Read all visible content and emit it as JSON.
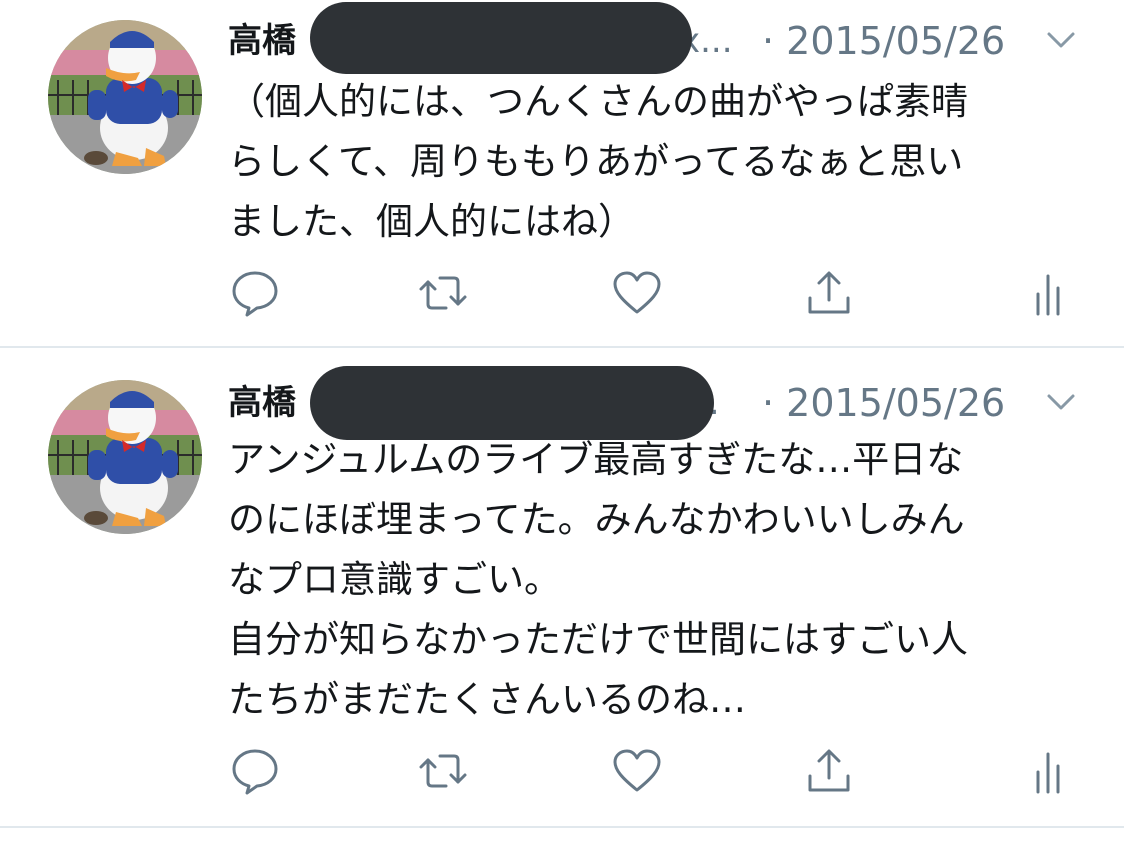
{
  "tweets": [
    {
      "name": "高橋",
      "handle_tail": "x...",
      "date": "· 2015/05/26",
      "lines": [
        "（個人的には、つんくさんの曲がやっぱ素晴",
        "らしくて、周りももりあがってるなぁと思い",
        "ました、個人的にはね）"
      ]
    },
    {
      "name": "高橋",
      "handle_tail": "..",
      "date": "· 2015/05/26",
      "lines": [
        "アンジュルムのライブ最高すぎたな…平日な",
        "のにほぼ埋まってた。みんなかわいいしみん",
        "なプロ意識すごい。",
        "自分が知らなかっただけで世間にはすごい人",
        "たちがまだたくさんいるのね…"
      ]
    }
  ],
  "icons": {
    "reply": "reply-icon",
    "retweet": "retweet-icon",
    "like": "heart-icon",
    "share": "share-icon",
    "analytics": "analytics-icon",
    "more": "chevron-down-icon"
  },
  "colors": {
    "text": "#14171a",
    "muted": "#657786",
    "divider": "#e1e8ed",
    "redaction": "#2e3236"
  }
}
